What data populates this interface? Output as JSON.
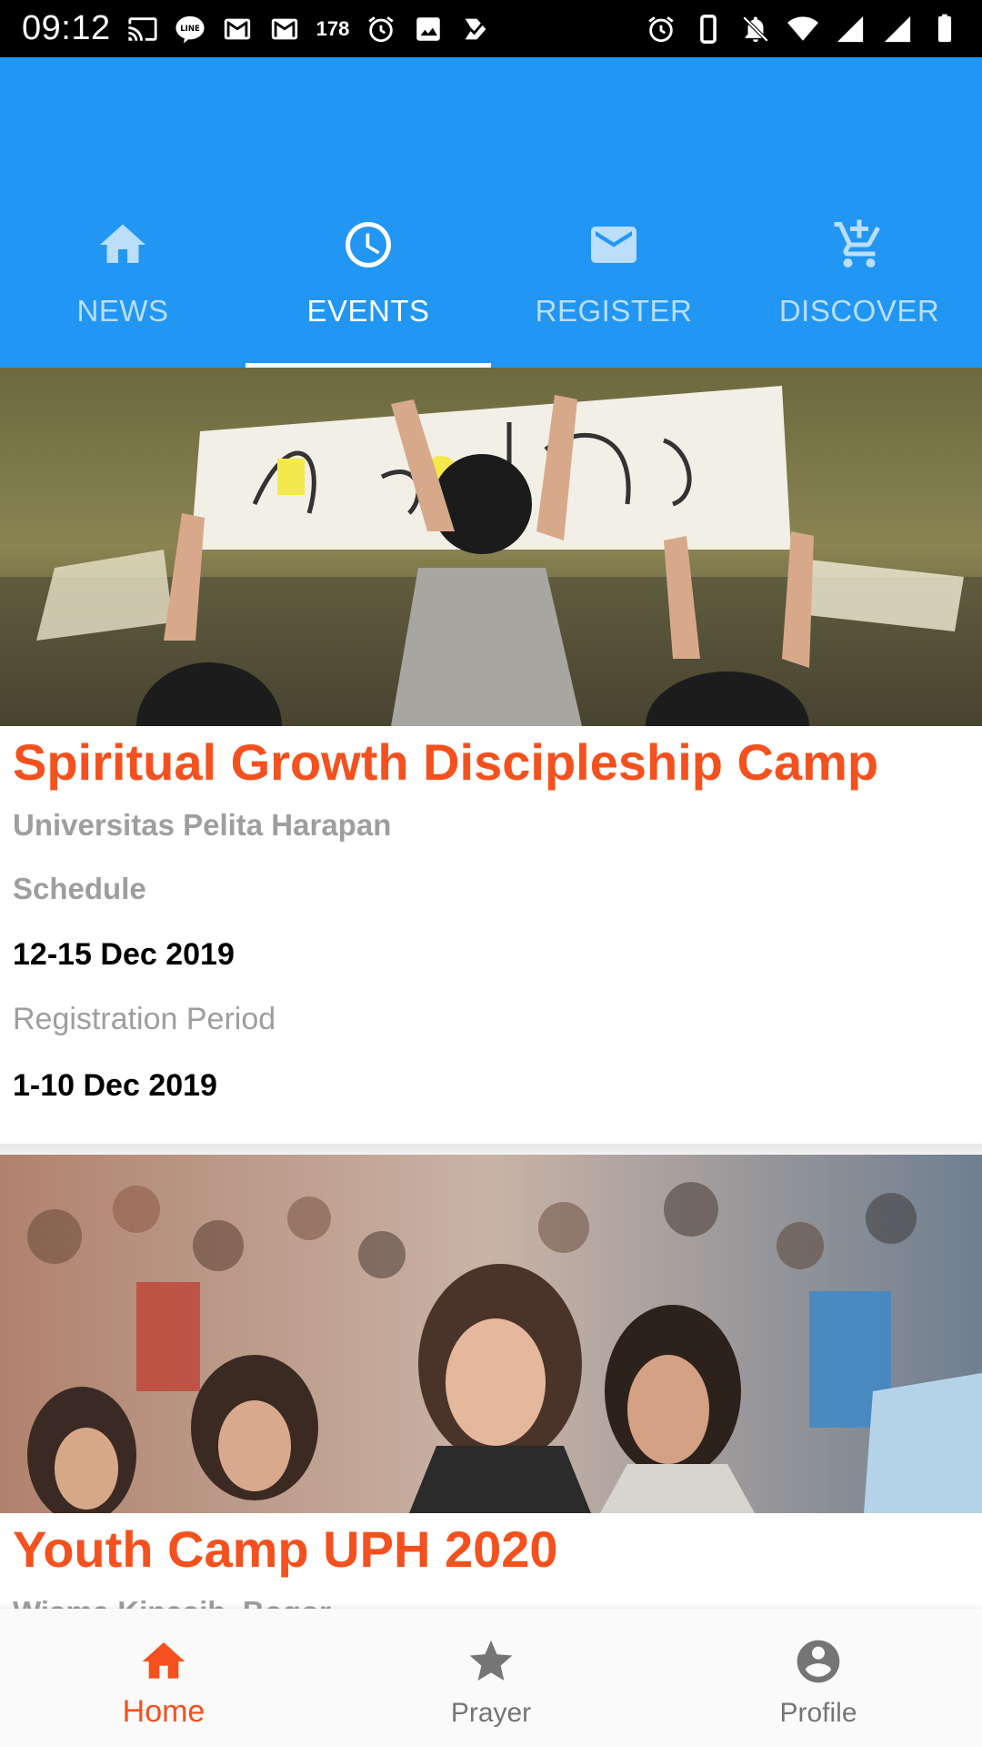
{
  "status_bar": {
    "time": "09:12",
    "notification_count": "178",
    "left_icons": [
      "cast-icon",
      "line-icon",
      "gmail-icon",
      "gmail-icon",
      "alarm-icon",
      "image-icon",
      "check-icon"
    ],
    "right_icons": [
      "alarm-icon",
      "vibrate-icon",
      "mute-icon",
      "wifi-icon",
      "signal-icon",
      "signal-icon",
      "battery-icon"
    ]
  },
  "header": {
    "tabs": [
      {
        "label": "NEWS",
        "icon": "home-icon",
        "active": false
      },
      {
        "label": "EVENTS",
        "icon": "clock-icon",
        "active": true
      },
      {
        "label": "REGISTER",
        "icon": "mail-icon",
        "active": false
      },
      {
        "label": "DISCOVER",
        "icon": "cart-icon",
        "active": false
      }
    ],
    "color": "#2196F3"
  },
  "events": [
    {
      "title": "Spiritual Growth Discipleship Camp",
      "venue": "Universitas Pelita Harapan",
      "schedule_label": "Schedule",
      "schedule": "12-15 Dec 2019",
      "registration_label": "Registration Period",
      "registration": "1-10 Dec 2019",
      "image": "banner-photo"
    },
    {
      "title": "Youth Camp UPH 2020",
      "venue": "Wisma Kinasih, Bogor",
      "image": "worship-crowd-photo"
    }
  ],
  "bottom_nav": {
    "items": [
      {
        "label": "Home",
        "icon": "home-icon",
        "active": true
      },
      {
        "label": "Prayer",
        "icon": "star-icon",
        "active": false
      },
      {
        "label": "Profile",
        "icon": "account-icon",
        "active": false
      }
    ]
  },
  "colors": {
    "accent": "#F4511E",
    "primary": "#2196F3"
  }
}
